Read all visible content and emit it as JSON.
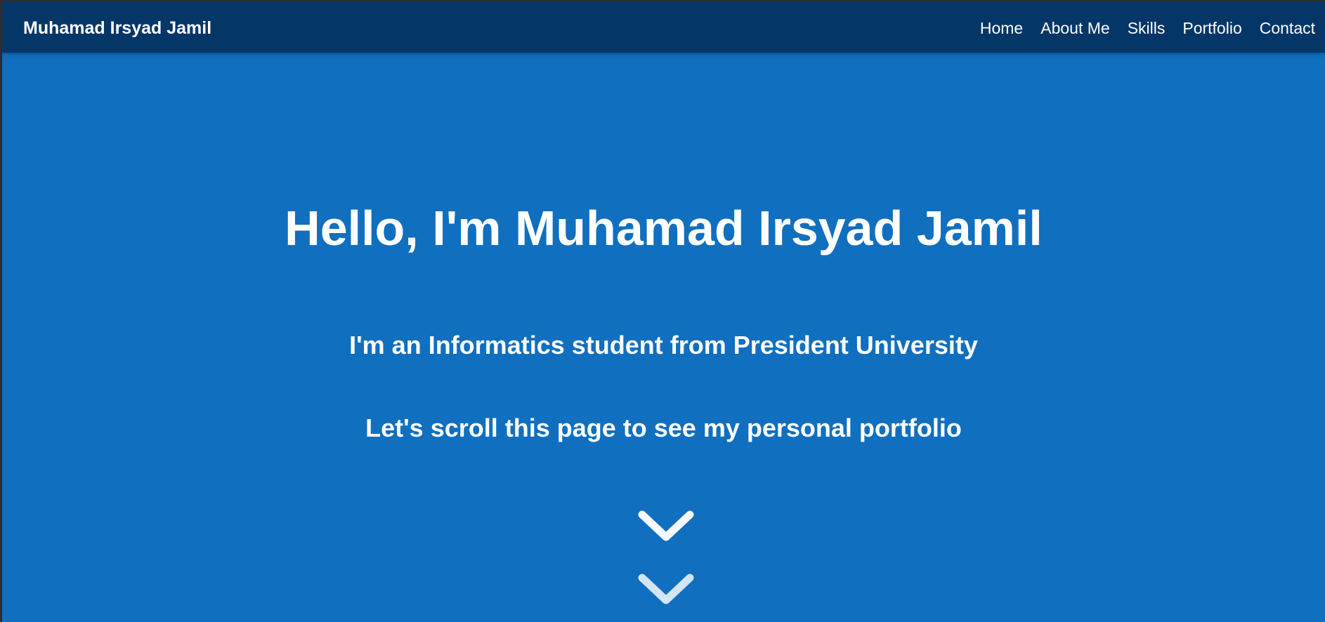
{
  "navbar": {
    "brand": "Muhamad Irsyad Jamil",
    "links": [
      "Home",
      "About Me",
      "Skills",
      "Portfolio",
      "Contact"
    ]
  },
  "hero": {
    "title": "Hello, I'm Muhamad Irsyad Jamil",
    "subtitle": "I'm an Informatics student from President University",
    "tagline": "Let's scroll this page to see my personal portfolio"
  },
  "icons": {
    "scroll_indicator": [
      "chevron-down-icon",
      "chevron-down-icon"
    ]
  },
  "colors": {
    "navbar_bg": "#053668",
    "hero_bg": "#106fbf",
    "text": "#ffffff"
  }
}
